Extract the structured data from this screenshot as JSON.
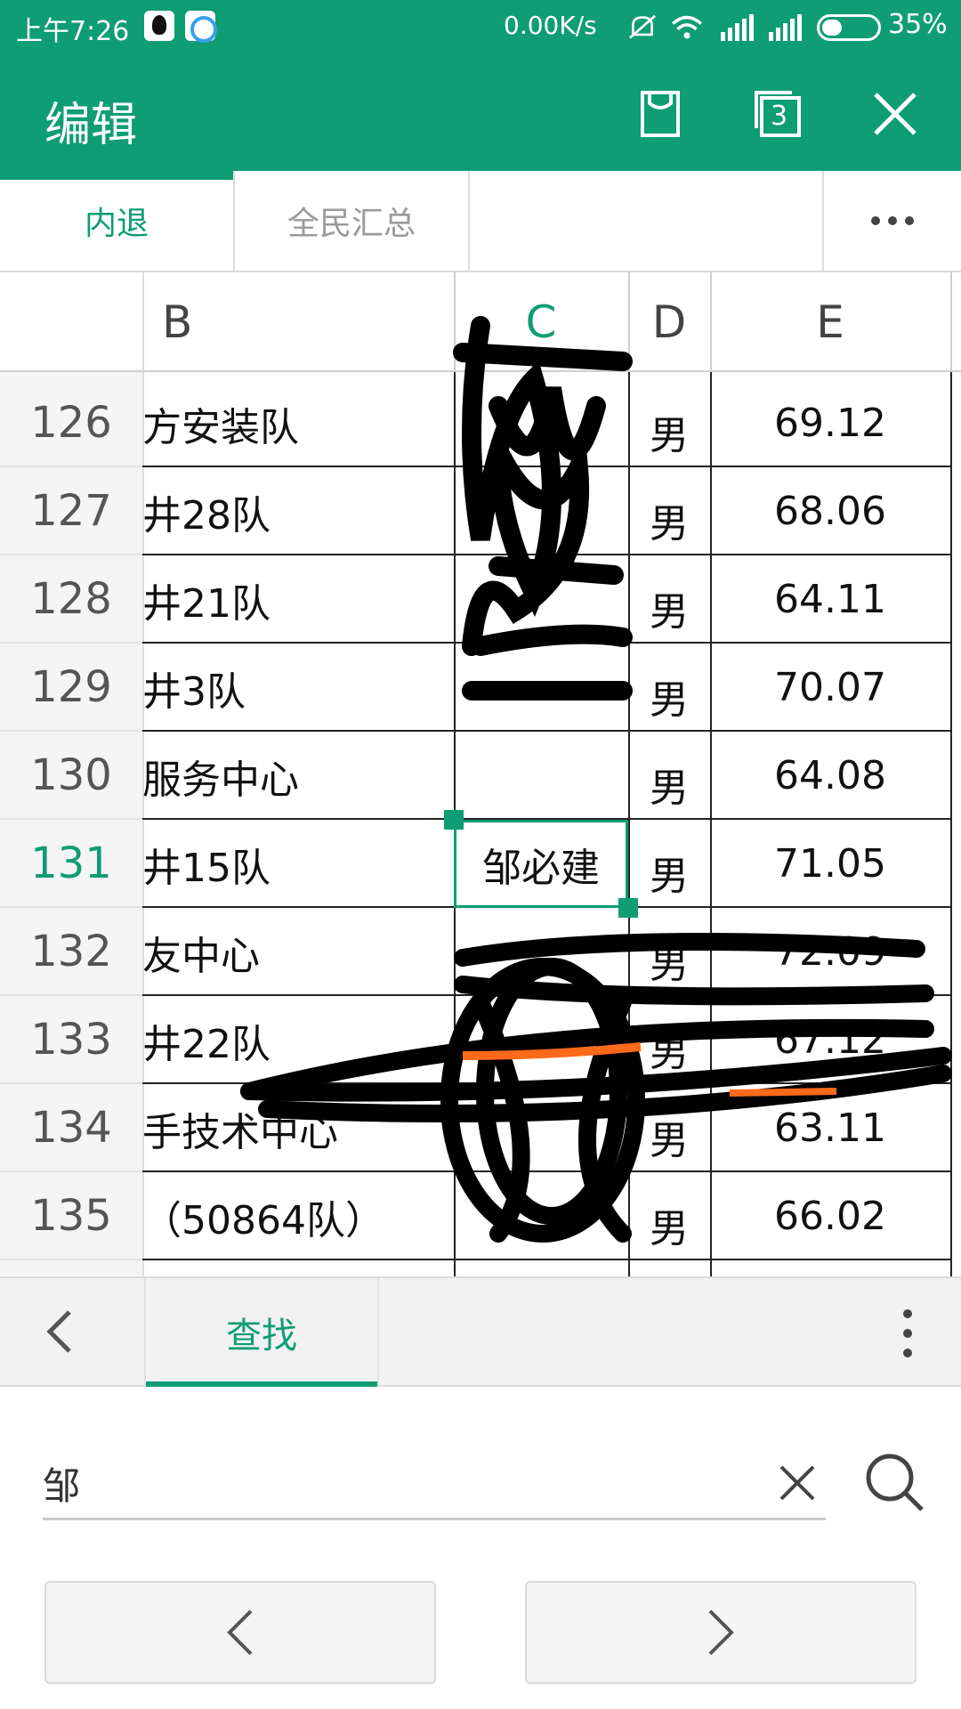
{
  "status_bar": {
    "time": "上午7:26",
    "net_speed": "0.00K/s",
    "battery": "35%"
  },
  "app_bar": {
    "title": "编辑",
    "icons": [
      "save-icon",
      "windows-count-icon",
      "close-icon"
    ],
    "window_count": "3"
  },
  "sheet_tabs": [
    {
      "label": "内退",
      "active": true
    },
    {
      "label": "全民汇总",
      "active": false
    }
  ],
  "grid": {
    "columns": [
      "B",
      "C",
      "D",
      "E"
    ],
    "selected_column": "C",
    "rows": [
      {
        "num": "126",
        "b": "方安装队",
        "c": "",
        "d": "男",
        "e": "69.12"
      },
      {
        "num": "127",
        "b": "井28队",
        "c": "",
        "d": "男",
        "e": "68.06"
      },
      {
        "num": "128",
        "b": "井21队",
        "c": "",
        "d": "男",
        "e": "64.11"
      },
      {
        "num": "129",
        "b": "井3队",
        "c": "",
        "d": "男",
        "e": "70.07"
      },
      {
        "num": "130",
        "b": "服务中心",
        "c": "",
        "d": "男",
        "e": "64.08"
      },
      {
        "num": "131",
        "b": "井15队",
        "c": "邹必建",
        "d": "男",
        "e": "71.05"
      },
      {
        "num": "132",
        "b": "友中心",
        "c": "",
        "d": "男",
        "e": "72.09"
      },
      {
        "num": "133",
        "b": "井22队",
        "c": "",
        "d": "男",
        "e": "67.12"
      },
      {
        "num": "134",
        "b": "手技术中心",
        "c": "",
        "d": "男",
        "e": "63.11"
      },
      {
        "num": "135",
        "b": "（50864队）",
        "c": "",
        "d": "男",
        "e": "66.02"
      }
    ],
    "selected_row": "131"
  },
  "find_panel": {
    "tab_label": "查找",
    "search_value": "邹",
    "prev_label": "‹",
    "next_label": "›"
  },
  "colors": {
    "accent": "#0f9d74",
    "grid_line": "#222222",
    "header_bg": "#f5f5f5"
  }
}
